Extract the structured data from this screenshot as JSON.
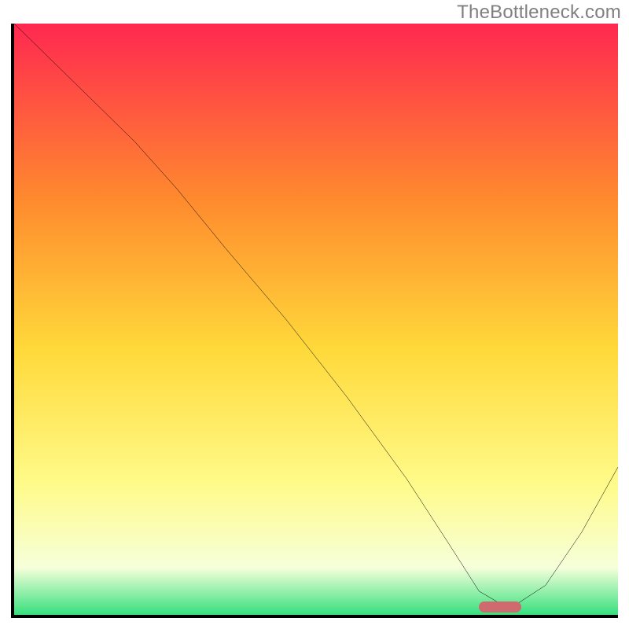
{
  "watermark": "TheBottleneck.com",
  "chart_data": {
    "type": "line",
    "title": "",
    "xlabel": "",
    "ylabel": "",
    "xlim": [
      0,
      100
    ],
    "ylim": [
      0,
      100
    ],
    "grid": false,
    "gradient_colors": {
      "top": "#ff2850",
      "mid_upper": "#ff8b2e",
      "mid": "#ffd93a",
      "mid_lower": "#fffb8a",
      "lower": "#f6ffda",
      "bottom": "#36e07e"
    },
    "series": [
      {
        "name": "bottleneck-curve",
        "color": "#000000",
        "x": [
          0,
          10,
          20,
          27,
          35,
          45,
          55,
          65,
          72,
          77,
          82,
          88,
          94,
          100
        ],
        "y": [
          100,
          90,
          80,
          72,
          62,
          50,
          37,
          23,
          12,
          4,
          1,
          5,
          14,
          25
        ]
      }
    ],
    "marker": {
      "name": "optimal-range",
      "x_start": 77,
      "x_end": 84,
      "y": 1,
      "color": "#cf6b6e"
    }
  }
}
